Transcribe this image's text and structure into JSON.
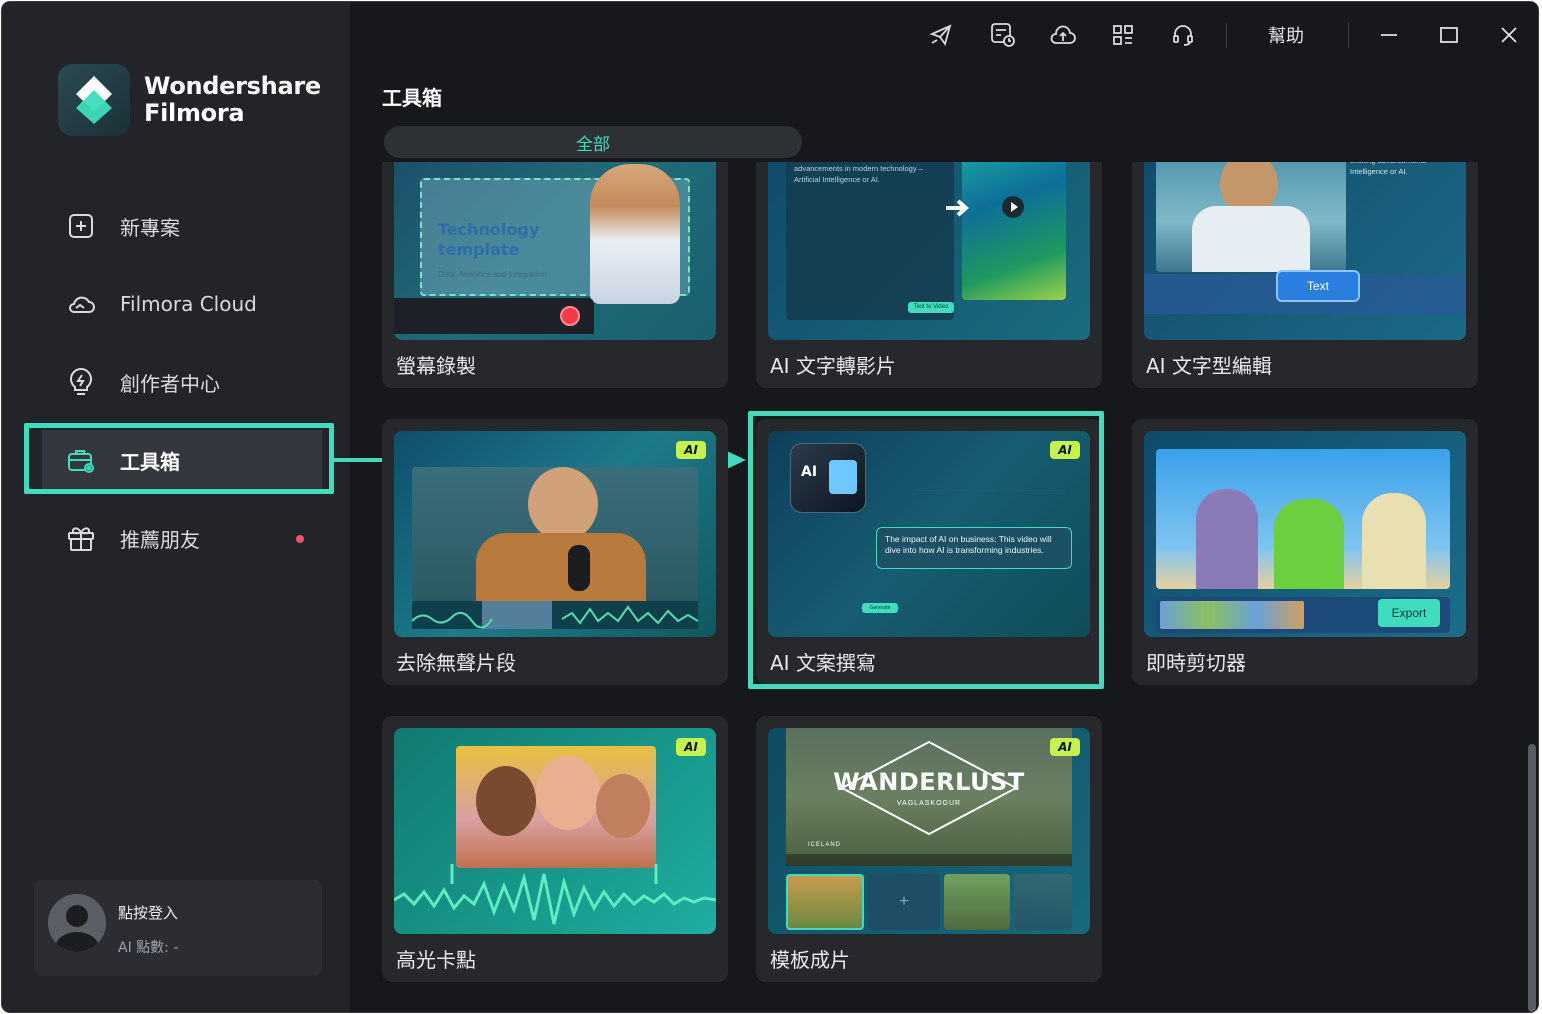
{
  "app": {
    "brand_line1": "Wondershare",
    "brand_line2": "Filmora",
    "help_label": "幫助"
  },
  "titlebar_icons": [
    "send-feedback-icon",
    "task-list-icon",
    "cloud-sync-icon",
    "apps-grid-icon",
    "support-headset-icon"
  ],
  "sidebar": {
    "items": [
      {
        "label": "新專案",
        "icon": "new-project-icon"
      },
      {
        "label": "Filmora Cloud",
        "icon": "cloud-icon"
      },
      {
        "label": "創作者中心",
        "icon": "lightbulb-icon"
      },
      {
        "label": "工具箱",
        "icon": "toolbox-icon",
        "active": true
      },
      {
        "label": "推薦朋友",
        "icon": "gift-icon",
        "notification_dot": true
      }
    ],
    "user": {
      "login_label": "點按登入",
      "points_label": "AI 點數: -"
    }
  },
  "main": {
    "title": "工具箱",
    "filter": "全部",
    "tools": [
      {
        "label": "螢幕錄製",
        "ai": false
      },
      {
        "label": "AI 文字轉影片",
        "ai": false
      },
      {
        "label": "AI 文字型編輯",
        "ai": false
      },
      {
        "label": "去除無聲片段",
        "ai": true,
        "badge": "AI"
      },
      {
        "label": "AI 文案撰寫",
        "ai": true,
        "badge": "AI",
        "highlighted": true
      },
      {
        "label": "即時剪切器",
        "ai": false
      },
      {
        "label": "高光卡點",
        "ai": true,
        "badge": "AI"
      },
      {
        "label": "模板成片",
        "ai": true,
        "badge": "AI"
      }
    ],
    "thumb_text": {
      "tech_title": "Technology template",
      "tech_sub": "Data, Analytics and Integration",
      "t2v_body": "discussing one of the most exciting advancements in modern technology – Artificial Intelligence or AI.",
      "t2v_button": "Text to Video",
      "textedit_text": "Good day everyone! Today, most exciting advancements Intelligence or AI.",
      "textedit_chip": "Text",
      "copy_prompt": "The impact of AI on business: This video will dive into how AI is transforming industries.",
      "copy_button": "Generate",
      "cutter_export": "Export",
      "template_title": "WANDERLUST",
      "template_sub": "VAGLASKOGUR",
      "template_place": "ICELAND"
    }
  },
  "colors": {
    "accent": "#3fdcbd",
    "ai_badge": "#c7f24b",
    "notification": "#f2516b",
    "window_bg": "#17181b",
    "sidebar_bg": "#222429",
    "card_bg": "#26282c"
  }
}
